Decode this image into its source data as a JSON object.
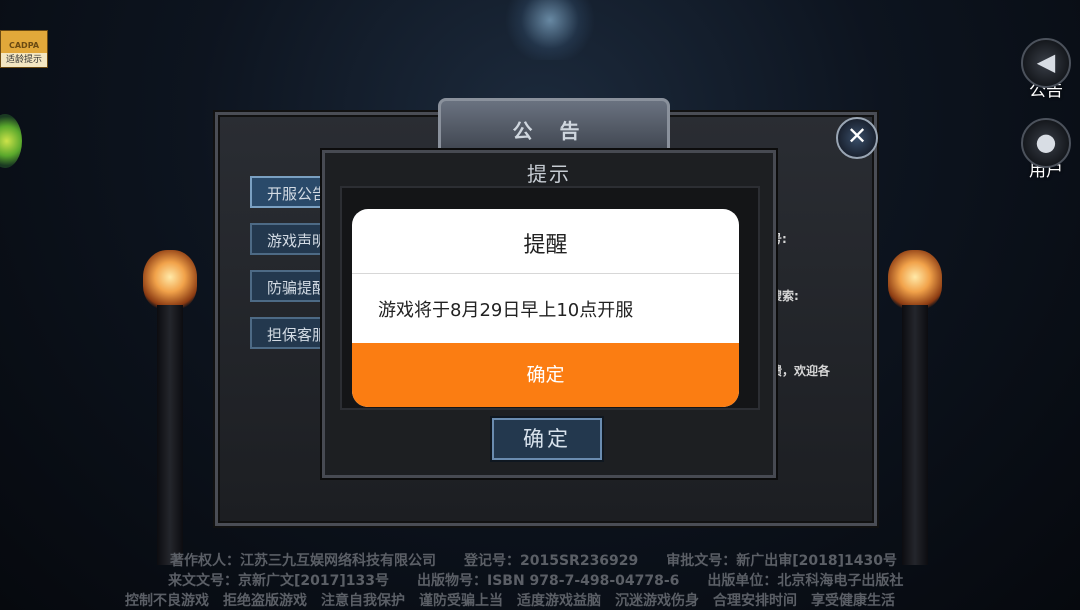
{
  "badge": {
    "top_text": "CADPA",
    "label": "适龄提示"
  },
  "side_buttons": {
    "announce": {
      "icon": "speaker-icon",
      "label": "公告"
    },
    "user": {
      "icon": "user-icon",
      "label": "用户"
    }
  },
  "outer_dialog": {
    "title": "公 告",
    "close_icon": "close-icon",
    "tabs": [
      {
        "label": "开服公告"
      },
      {
        "label": "游戏声明"
      },
      {
        "label": "防骗提醒"
      },
      {
        "label": "担保客服"
      }
    ],
    "content_fragments": [
      "号:",
      "搜索:",
      "馈，欢迎各"
    ]
  },
  "inner_dialog": {
    "title": "提示",
    "ok_label": "确定"
  },
  "alert": {
    "title": "提醒",
    "message": "游戏将于8月29日早上10点开服",
    "confirm_label": "确定",
    "confirm_color": "#fb7d12"
  },
  "footer": {
    "line1": "著作权人：江苏三九互娱网络科技有限公司　　登记号：2015SR236929　　审批文号：新广出审[2018]1430号",
    "line2": "来文文号：京新广文[2017]133号　　出版物号：ISBN 978-7-498-04778-6　　出版单位：北京科海电子出版社",
    "line3": "控制不良游戏　拒绝盗版游戏　注意自我保护　谨防受骗上当　适度游戏益脑　沉迷游戏伤身　合理安排时间　享受健康生活"
  }
}
